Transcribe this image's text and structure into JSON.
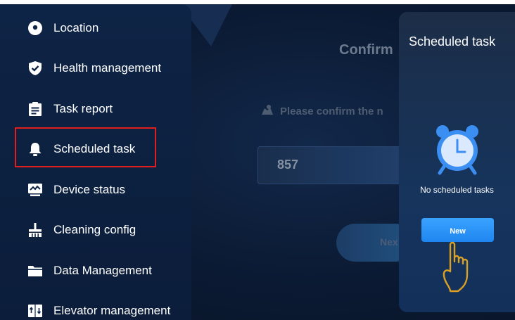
{
  "sidebar": {
    "items": [
      {
        "label": "Location",
        "icon": "location-pin-icon"
      },
      {
        "label": "Health management",
        "icon": "shield-check-icon"
      },
      {
        "label": "Task report",
        "icon": "clipboard-icon"
      },
      {
        "label": "Scheduled task",
        "icon": "bell-icon"
      },
      {
        "label": "Device status",
        "icon": "monitor-chart-icon"
      },
      {
        "label": "Cleaning config",
        "icon": "broom-icon"
      },
      {
        "label": "Data Management",
        "icon": "folder-icon"
      },
      {
        "label": "Elevator management",
        "icon": "elevator-icon"
      }
    ],
    "selected": "Scheduled task"
  },
  "main": {
    "title": "Confirm",
    "hint": "Please confirm the n",
    "number": "857",
    "next_label": "Nex"
  },
  "panel": {
    "title": "Scheduled task",
    "empty_text": "No scheduled tasks",
    "new_label": "New"
  },
  "colors": {
    "highlight": "#e0201e",
    "accent": "#2b95f8",
    "clock": "#3b8ff2",
    "hand": "#d9a024"
  }
}
